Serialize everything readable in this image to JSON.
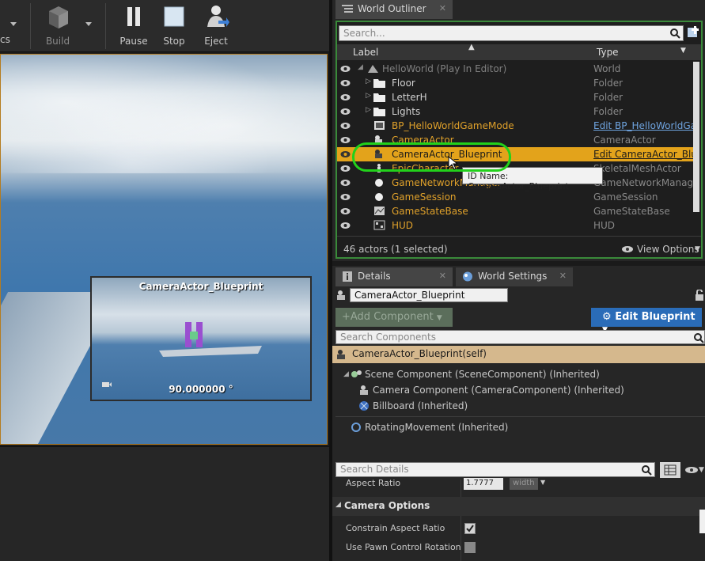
{
  "toolbar": {
    "partial_label": "cs",
    "build_label": "Build",
    "pause_label": "Pause",
    "stop_label": "Stop",
    "eject_label": "Eject"
  },
  "viewport": {
    "pip_title": "CameraActor_Blueprint",
    "pip_angle": "90.000000 °"
  },
  "outliner": {
    "tab_label": "World Outliner",
    "search_placeholder": "Search...",
    "col_label": "Label",
    "col_type": "Type",
    "rows": [
      {
        "label": "HelloWorld (Play In Editor)",
        "type": "World"
      },
      {
        "label": "Floor",
        "type": "Folder"
      },
      {
        "label": "LetterH",
        "type": "Folder"
      },
      {
        "label": "Lights",
        "type": "Folder"
      },
      {
        "label": "BP_HelloWorldGameMode",
        "type": "Edit BP_HelloWorldGa"
      },
      {
        "label": "CameraActor",
        "type": "CameraActor"
      },
      {
        "label": "CameraActor_Blueprint",
        "type": "Edit CameraActor_Blu"
      },
      {
        "label": "EpicCharacter",
        "type": "SkeletalMeshActor"
      },
      {
        "label": "GameNetworkManager",
        "type": "GameNetworkManager"
      },
      {
        "label": "GameSession",
        "type": "GameSession"
      },
      {
        "label": "GameStateBase",
        "type": "GameStateBase"
      },
      {
        "label": "HUD",
        "type": "HUD"
      }
    ],
    "status": "46 actors (1 selected)",
    "view_options": "View Options",
    "tooltip": "ID Name: CameraActor_Blueprint"
  },
  "details": {
    "tab_details": "Details",
    "tab_world_settings": "World Settings",
    "name_value": "CameraActor_Blueprint",
    "add_component": "+Add Component",
    "edit_blueprint": "Edit Blueprint",
    "search_components": "Search Components",
    "self_row": "CameraActor_Blueprint(self)",
    "components": [
      "Scene Component (SceneComponent) (Inherited)",
      "Camera Component (CameraComponent) (Inherited)",
      "Billboard (Inherited)",
      "RotatingMovement (Inherited)"
    ],
    "search_details": "Search Details",
    "aspect_ratio_label": "Aspect Ratio",
    "aspect_ratio_value": "1.7777",
    "aspect_ratio_unit": "width",
    "camera_options": "Camera Options",
    "constrain_aspect": "Constrain Aspect Ratio",
    "use_pawn_control": "Use Pawn Control Rotation"
  },
  "colors": {
    "selection": "#e3a31b",
    "highlight": "#22d11b",
    "edit_blueprint_bg": "#2a6cb8"
  }
}
